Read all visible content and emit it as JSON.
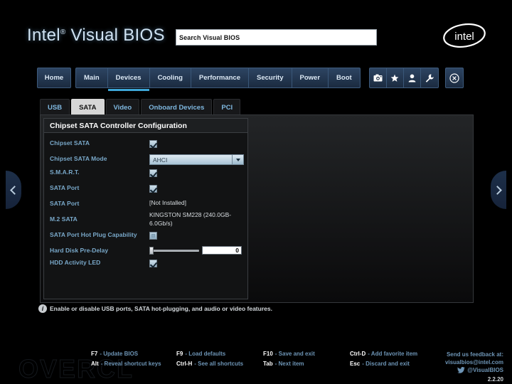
{
  "header": {
    "brand_prefix": "Intel",
    "brand_reg": "®",
    "brand_suffix": " Visual BIOS",
    "logo_text": "intel",
    "logo_name": "intel-logo"
  },
  "search": {
    "value": "Search Visual BIOS",
    "placeholder": "Search Visual BIOS",
    "icon": "search-icon"
  },
  "topnav": {
    "home_label": "Home",
    "items": [
      {
        "label": "Main",
        "active": false
      },
      {
        "label": "Devices",
        "active": true
      },
      {
        "label": "Cooling",
        "active": false
      },
      {
        "label": "Performance",
        "active": false
      },
      {
        "label": "Security",
        "active": false
      },
      {
        "label": "Power",
        "active": false
      },
      {
        "label": "Boot",
        "active": false
      }
    ],
    "icons": [
      {
        "name": "camera-icon",
        "glyph": "📷"
      },
      {
        "name": "star-icon",
        "glyph": "★"
      },
      {
        "name": "user-icon",
        "glyph": "👤"
      },
      {
        "name": "wrench-icon",
        "glyph": "🔧"
      }
    ],
    "close": {
      "name": "close-icon",
      "glyph": "⊗"
    }
  },
  "subtabs": [
    {
      "label": "USB",
      "active": false
    },
    {
      "label": "SATA",
      "active": true
    },
    {
      "label": "Video",
      "active": false
    },
    {
      "label": "Onboard Devices",
      "active": false
    },
    {
      "label": "PCI",
      "active": false
    }
  ],
  "card": {
    "title": "Chipset SATA Controller Configuration",
    "rows": [
      {
        "label": "Chipset SATA",
        "type": "checkbox",
        "checked": true
      },
      {
        "label": "Chipset SATA Mode",
        "type": "dropdown",
        "value": "AHCI"
      },
      {
        "label": "S.M.A.R.T.",
        "type": "checkbox",
        "checked": true
      },
      {
        "label": "SATA Port",
        "type": "checkbox",
        "checked": true
      },
      {
        "label": "SATA Port",
        "type": "text",
        "value": "[Not Installed]"
      },
      {
        "label": "M.2 SATA",
        "type": "text",
        "value": "KINGSTON SM228 (240.0GB-6.0Gb/s)"
      },
      {
        "label": "SATA Port Hot Plug Capability",
        "type": "checkbox",
        "checked": false
      },
      {
        "label": "Hard Disk Pre-Delay",
        "type": "slider",
        "value": "0",
        "slider_pct": 0
      },
      {
        "label": "HDD Activity LED",
        "type": "checkbox",
        "checked": true
      }
    ]
  },
  "help": {
    "icon": "info-icon",
    "text": "Enable or disable USB ports, SATA hot-plugging, and audio or video features."
  },
  "side_nav": {
    "prev": {
      "name": "prev-page-arrow",
      "glyph": "‹"
    },
    "next": {
      "name": "next-page-arrow",
      "glyph": "›"
    }
  },
  "footer": {
    "watermark": "OVERCL",
    "shortcuts_row1": [
      {
        "key": "F7",
        "desc": "- Update BIOS"
      },
      {
        "key": "F9",
        "desc": "- Load defaults"
      },
      {
        "key": "F10",
        "desc": "- Save and exit"
      },
      {
        "key": "Ctrl-D",
        "desc": "- Add favorite item"
      }
    ],
    "shortcuts_row2": [
      {
        "key": "Alt",
        "desc": "- Reveal shortcut keys"
      },
      {
        "key": "Ctrl-H",
        "desc": "- See all shortcuts"
      },
      {
        "key": "Tab",
        "desc": "- Next item"
      },
      {
        "key": "Esc",
        "desc": "- Discard and exit"
      }
    ],
    "feedback_line1": "Send us feedback at:",
    "feedback_line2": "visualbios@intel.com",
    "twitter_handle": "@VisualBIOS",
    "twitter_icon": "twitter-icon",
    "version": "2.2.20"
  },
  "colors": {
    "accent_blue": "#3ea7d8",
    "label_blue": "#79a8c9",
    "nav_blue": "#2d4462"
  }
}
